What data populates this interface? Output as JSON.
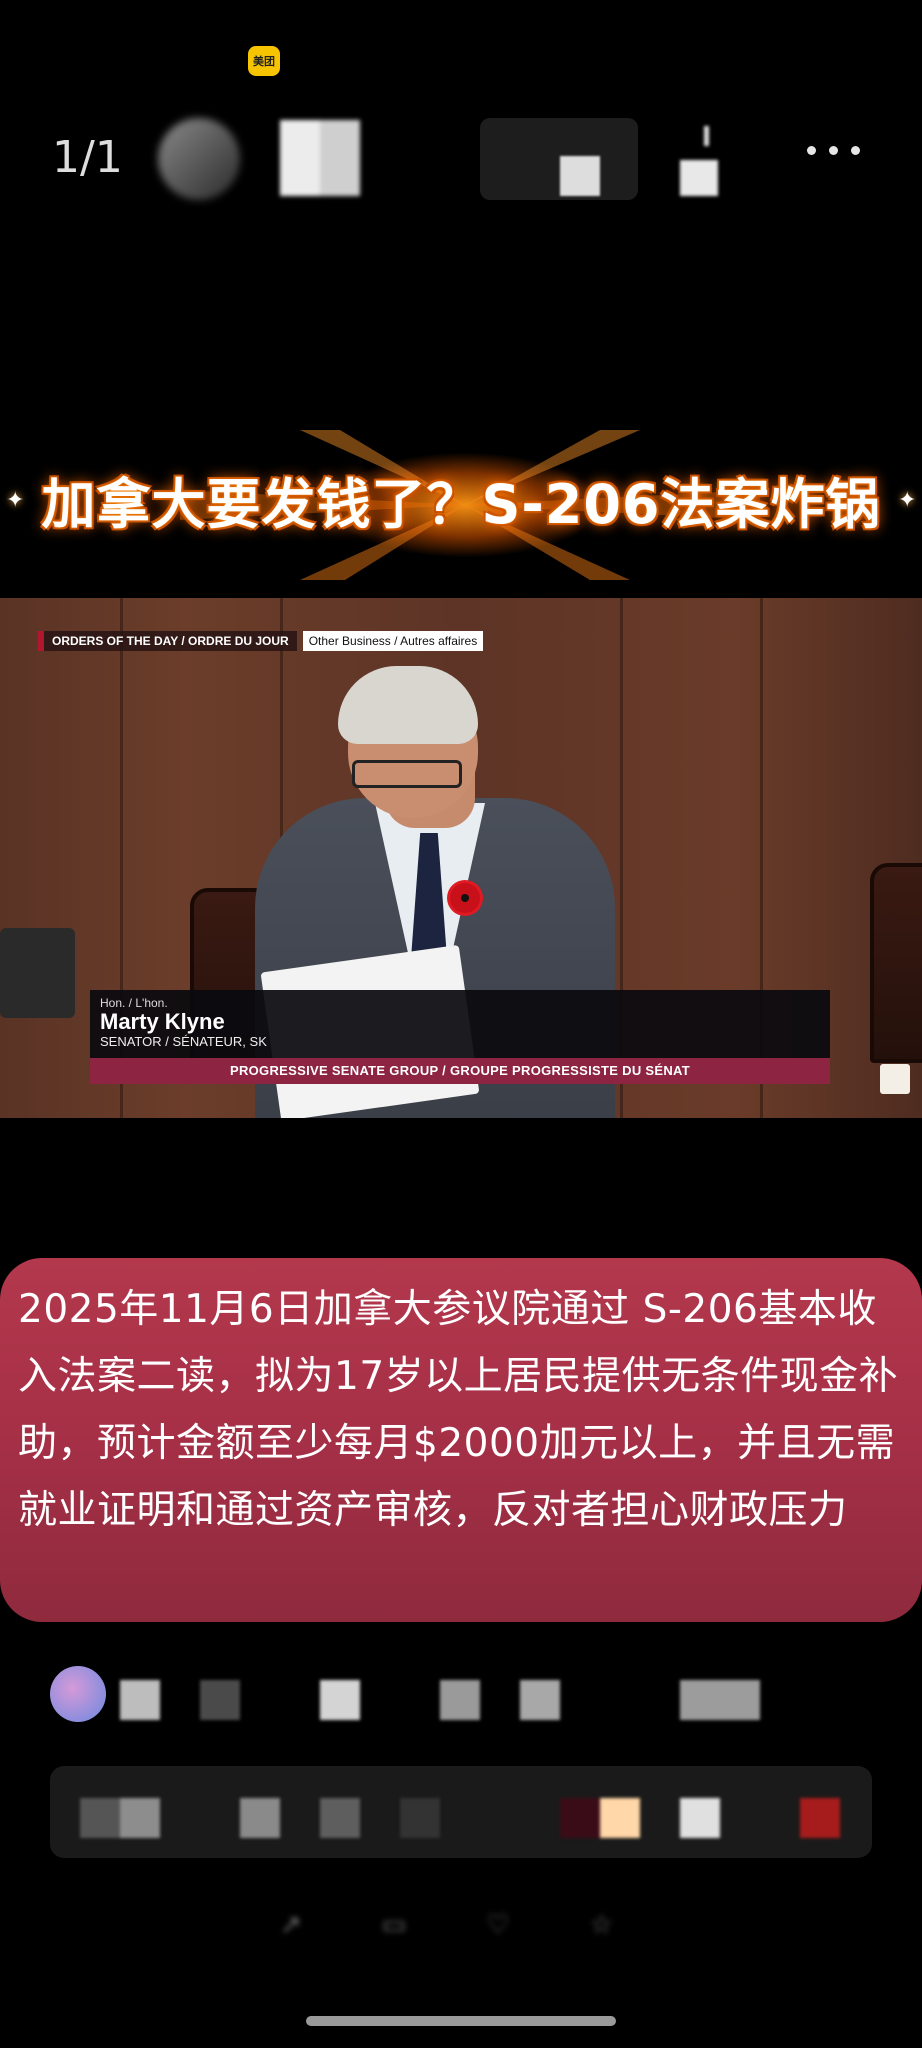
{
  "top_bar": {
    "app_badge": "美团",
    "page_indicator": "1/1"
  },
  "banner": {
    "title": "加拿大要发钱了？S-206法案炸锅"
  },
  "video": {
    "section_label": "ORDERS OF THE DAY / ORDRE DU JOUR",
    "topic_label": "Other Business / Autres affaires",
    "honorific": "Hon. / L'hon.",
    "speaker_name": "Marty Klyne",
    "speaker_role": "SENATOR / SÉNATEUR, SK",
    "group": "PROGRESSIVE SENATE GROUP / GROUPE PROGRESSISTE DU SÉNAT"
  },
  "caption": {
    "text": "2025年11月6日加拿大参议院通过 S-206基本收入法案二读，拟为17岁以上居民提供无条件现金补助，预计金额至少每月$2000加元以上，并且无需就业证明和通过资产审核，反对者担心财政压力"
  },
  "colors": {
    "caption_bg": "#a73047",
    "group_bar": "#8c2442",
    "badge": "#f6c400"
  }
}
